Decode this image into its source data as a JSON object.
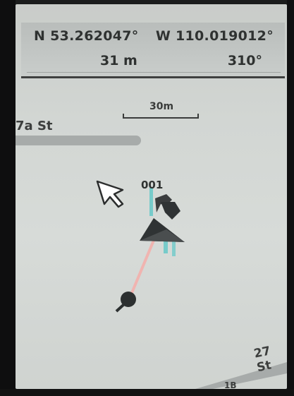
{
  "data_fields": {
    "latitude": "N 53.262047°",
    "longitude": "W 110.019012°",
    "elevation": "31 m",
    "heading": "310°"
  },
  "map": {
    "scale_label": "30m",
    "road_top_label": "7a St",
    "road_bottom_label": "27 St",
    "bottom_label": "1B",
    "waypoint_label": "001"
  },
  "icons": {
    "cursor": "arrow-cursor-icon",
    "position": "position-arrow-icon",
    "waypoint": "flag-waypoint-icon",
    "track_point": "track-point-icon"
  },
  "colors": {
    "screen_bg": "#d2d6d3",
    "road": "#a7abaa",
    "track_line": "#f0b4b0",
    "trail": "#5fc7c7",
    "text": "#2f3231"
  }
}
